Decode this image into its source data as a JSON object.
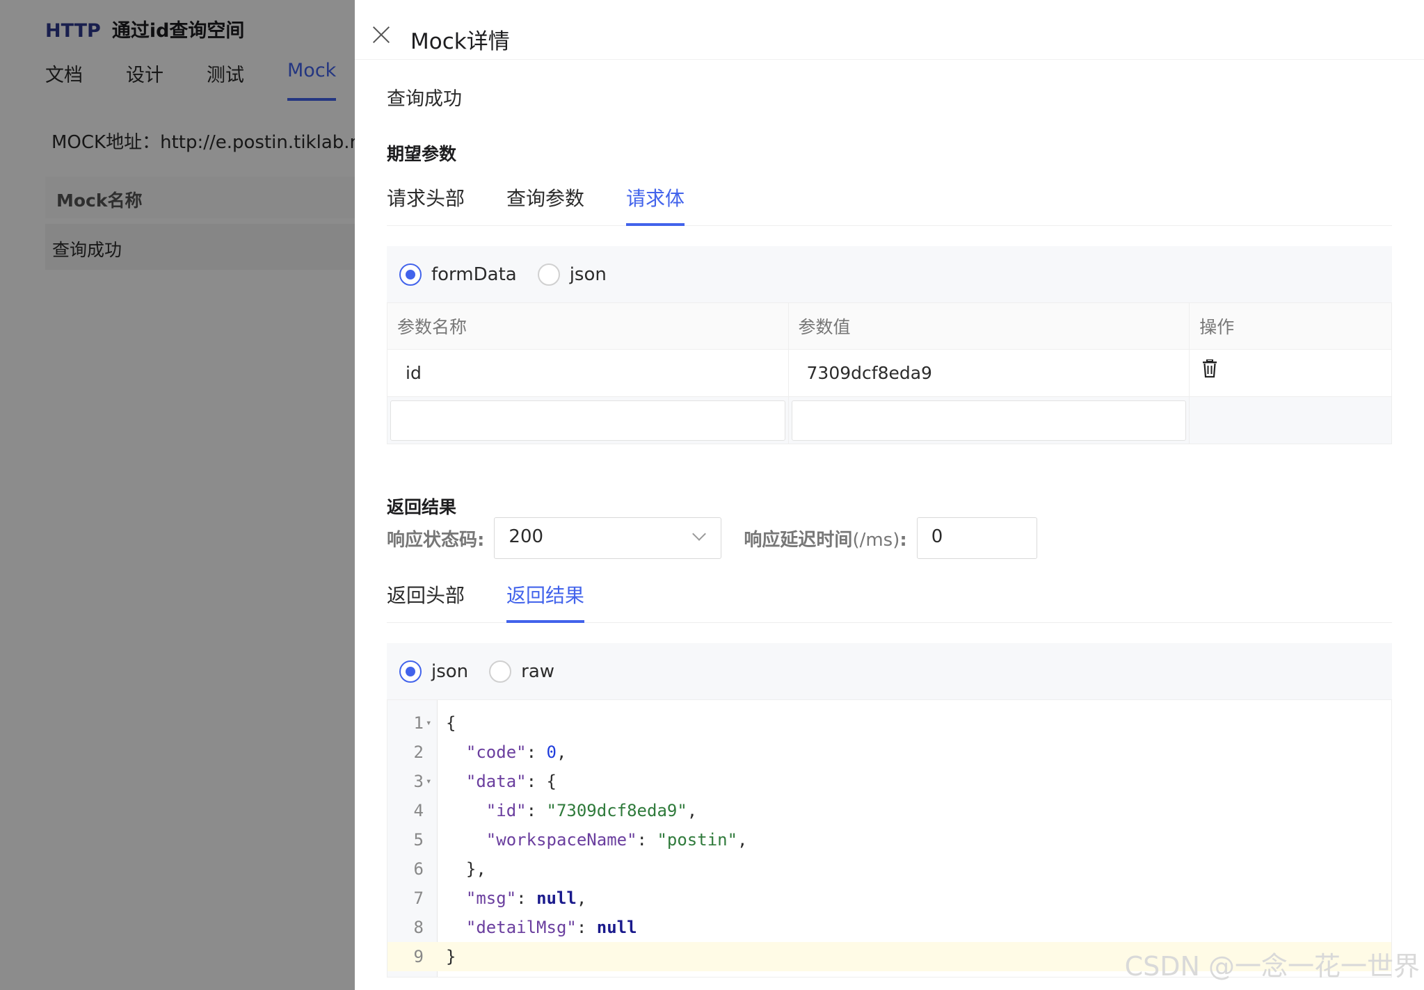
{
  "background": {
    "protocol": "HTTP",
    "api_title": "通过id查询空间",
    "tabs": [
      "文档",
      "设计",
      "测试",
      "Mock"
    ],
    "active_tab": "Mock",
    "mock_url": "MOCK地址：http://e.postin.tiklab.ne",
    "table_header": "Mock名称",
    "table_row": "查询成功"
  },
  "drawer": {
    "title": "Mock详情",
    "mock_name": "查询成功",
    "expect_section": "期望参数",
    "request_tabs": [
      "请求头部",
      "查询参数",
      "请求体"
    ],
    "request_active_tab": "请求体",
    "body_types": [
      "formData",
      "json"
    ],
    "body_type_selected": "formData",
    "params_table": {
      "headers": [
        "参数名称",
        "参数值",
        "操作"
      ],
      "rows": [
        {
          "name": "id",
          "value": "7309dcf8eda9"
        }
      ]
    },
    "result_section": "返回结果",
    "status_label": "响应状态码",
    "status_value": "200",
    "delay_label_main": "响应延迟时间",
    "delay_label_unit": "(/ms)",
    "delay_value": "0",
    "response_tabs": [
      "返回头部",
      "返回结果"
    ],
    "response_active_tab": "返回结果",
    "response_types": [
      "json",
      "raw"
    ],
    "response_type_selected": "json",
    "code_lines": [
      "{",
      "  \"code\": 0,",
      "  \"data\": {",
      "    \"id\": \"7309dcf8eda9\",",
      "    \"workspaceName\": \"postin\",",
      "  },",
      "  \"msg\": null,",
      "  \"detailMsg\": null",
      "}"
    ]
  },
  "watermark": "CSDN @一念一花一世界",
  "colors": {
    "accent": "#4263eb",
    "overlay": "rgba(0,0,0,0.45)"
  }
}
